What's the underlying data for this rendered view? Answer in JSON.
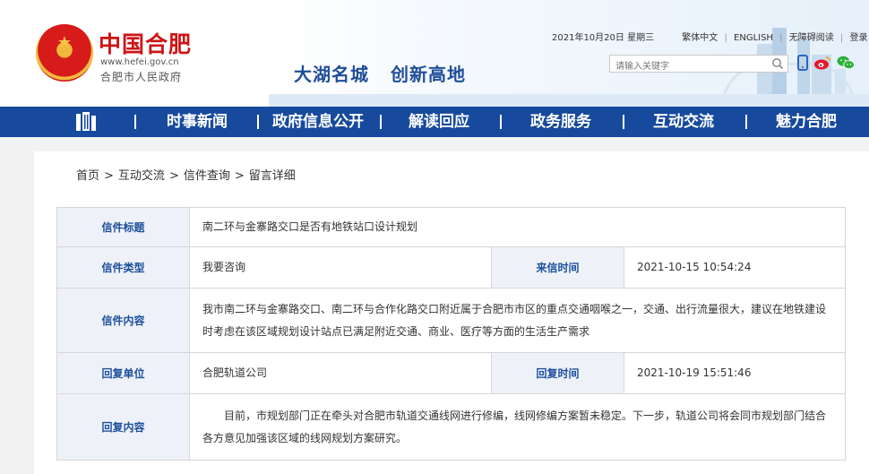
{
  "header": {
    "site_name": "中国合肥",
    "site_url": "www.hefei.gov.cn",
    "site_sub": "合肥市人民政府",
    "slogan_1": "大湖名城",
    "slogan_2": "创新高地",
    "date": "2021年10月20日 星期三",
    "links": [
      "繁体中文",
      "ENGLISH",
      "无障碍阅读",
      "登录"
    ],
    "search_placeholder": "请输入关键字",
    "icons": [
      "mobile-icon",
      "weibo-icon",
      "wechat-icon"
    ]
  },
  "nav": {
    "items": [
      "时事新闻",
      "政府信息公开",
      "解读回应",
      "政务服务",
      "互动交流",
      "魅力合肥"
    ]
  },
  "breadcrumb": [
    "首页",
    "互动交流",
    "信件查询",
    "留言详细"
  ],
  "letter": {
    "title_label": "信件标题",
    "title_value": "南二环与金寨路交口是否有地铁站口设计规划",
    "type_label": "信件类型",
    "type_value": "我要咨询",
    "sent_label": "来信时间",
    "sent_value": "2021-10-15 10:54:24",
    "content_label": "信件内容",
    "content_value": "我市南二环与金寨路交口、南二环与合作化路交口附近属于合肥市市区的重点交通咽喉之一，交通、出行流量很大，建议在地铁建设时考虑在该区域规划设计站点已满足附近交通、商业、医疗等方面的生活生产需求",
    "unit_label": "回复单位",
    "unit_value": "合肥轨道公司",
    "reply_time_label": "回复时间",
    "reply_time_value": "2021-10-19 15:51:46",
    "reply_label": "回复内容",
    "reply_value": "目前，市规划部门正在牵头对合肥市轨道交通线网进行修编，线网修编方案暂未稳定。下一步，轨道公司将会同市规划部门结合各方意见加强该区域的线网规划方案研究。"
  },
  "colors": {
    "nav_bg": "#174a9c",
    "label_text": "#1c4f9c",
    "label_bg": "#eef2f8",
    "logo_red": "#cc1515"
  }
}
